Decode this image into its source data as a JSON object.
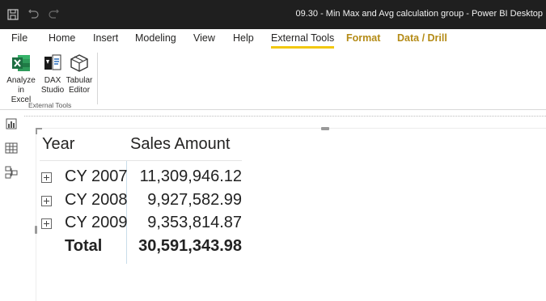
{
  "window": {
    "title": "09.30 - Min Max and Avg calculation group - Power BI Desktop"
  },
  "ribbon_tabs": [
    {
      "label": "File"
    },
    {
      "label": "Home"
    },
    {
      "label": "Insert"
    },
    {
      "label": "Modeling"
    },
    {
      "label": "View"
    },
    {
      "label": "Help"
    },
    {
      "label": "External Tools",
      "active": true
    },
    {
      "label": "Format",
      "contextual": true
    },
    {
      "label": "Data / Drill",
      "contextual": true
    }
  ],
  "ribbon": {
    "buttons": [
      {
        "label": "Analyze in\nExcel",
        "icon": "excel-icon"
      },
      {
        "label": "DAX\nStudio",
        "icon": "dax-studio-icon"
      },
      {
        "label": "Tabular\nEditor",
        "icon": "tabular-editor-icon"
      }
    ],
    "group_label": "External Tools"
  },
  "left_rail": [
    "report-view-icon",
    "data-view-icon",
    "model-view-icon"
  ],
  "matrix": {
    "headers": {
      "row_header": "Year",
      "value_header": "Sales Amount"
    },
    "rows": [
      {
        "label": "CY 2007",
        "value": "11,309,946.12"
      },
      {
        "label": "CY 2008",
        "value": "9,927,582.99"
      },
      {
        "label": "CY 2009",
        "value": "9,353,814.87"
      }
    ],
    "total": {
      "label": "Total",
      "value": "30,591,343.98"
    }
  },
  "colors": {
    "titlebar_bg": "#1f1f1f",
    "active_tab_underline": "#f2c811",
    "contextual_tab_text": "#b48b16",
    "excel_green": "#1d6f42"
  }
}
